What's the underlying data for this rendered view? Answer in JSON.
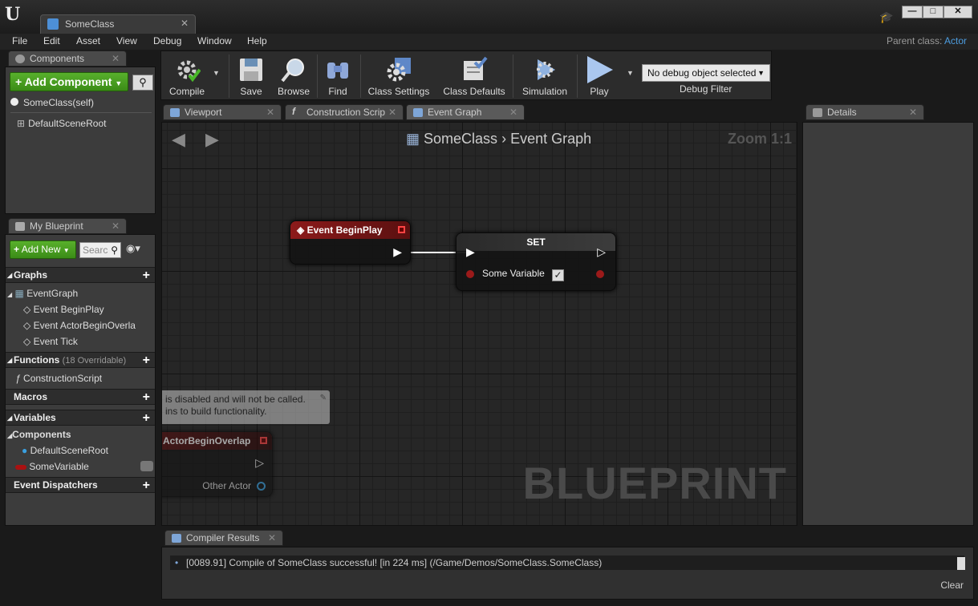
{
  "window": {
    "tab_title": "SomeClass",
    "logo": "U"
  },
  "menu": [
    "File",
    "Edit",
    "Asset",
    "View",
    "Debug",
    "Window",
    "Help"
  ],
  "parent_class": {
    "label": "Parent class:",
    "value": "Actor"
  },
  "components_panel": {
    "title": "Components",
    "add_label": "Add Component",
    "items": [
      "SomeClass(self)",
      "DefaultSceneRoot"
    ]
  },
  "blueprint_panel": {
    "title": "My Blueprint",
    "add_label": "Add New",
    "search_placeholder": "Searc",
    "graphs_title": "Graphs",
    "graph_name": "EventGraph",
    "events": [
      "Event BeginPlay",
      "Event ActorBeginOverla",
      "Event Tick"
    ],
    "functions_title": "Functions",
    "functions_hint": "(18 Overridable)",
    "function_item": "ConstructionScript",
    "macros_title": "Macros",
    "variables_title": "Variables",
    "components_group": "Components",
    "var_component": "DefaultSceneRoot",
    "var_item": "SomeVariable",
    "dispatchers_title": "Event Dispatchers"
  },
  "toolbar": {
    "compile": "Compile",
    "save": "Save",
    "browse": "Browse",
    "find": "Find",
    "class_settings": "Class Settings",
    "class_defaults": "Class Defaults",
    "simulation": "Simulation",
    "play": "Play",
    "debug_object": "No debug object selected",
    "debug_filter": "Debug Filter"
  },
  "graph_tabs": [
    "Viewport",
    "Construction Scrip",
    "Event Graph"
  ],
  "graph": {
    "breadcrumb_root": "SomeClass",
    "breadcrumb_leaf": "Event Graph",
    "zoom": "Zoom 1:1",
    "watermark": "BLUEPRINT",
    "node_beginplay": "Event BeginPlay",
    "node_set": "SET",
    "set_var": "Some Variable",
    "comment_line1": "is disabled and will not be called.",
    "comment_line2": "ins to build functionality.",
    "node_overlap": "ActorBeginOverlap",
    "overlap_pin": "Other Actor"
  },
  "details": {
    "title": "Details"
  },
  "compiler": {
    "title": "Compiler Results",
    "message": "[0089.91] Compile of SomeClass successful! [in 224 ms] (/Game/Demos/SomeClass.SomeClass)",
    "clear": "Clear"
  },
  "colors": {
    "accent_blue": "#4d9de0",
    "event_red": "#8c1a1a",
    "add_green": "#4a9f22"
  }
}
